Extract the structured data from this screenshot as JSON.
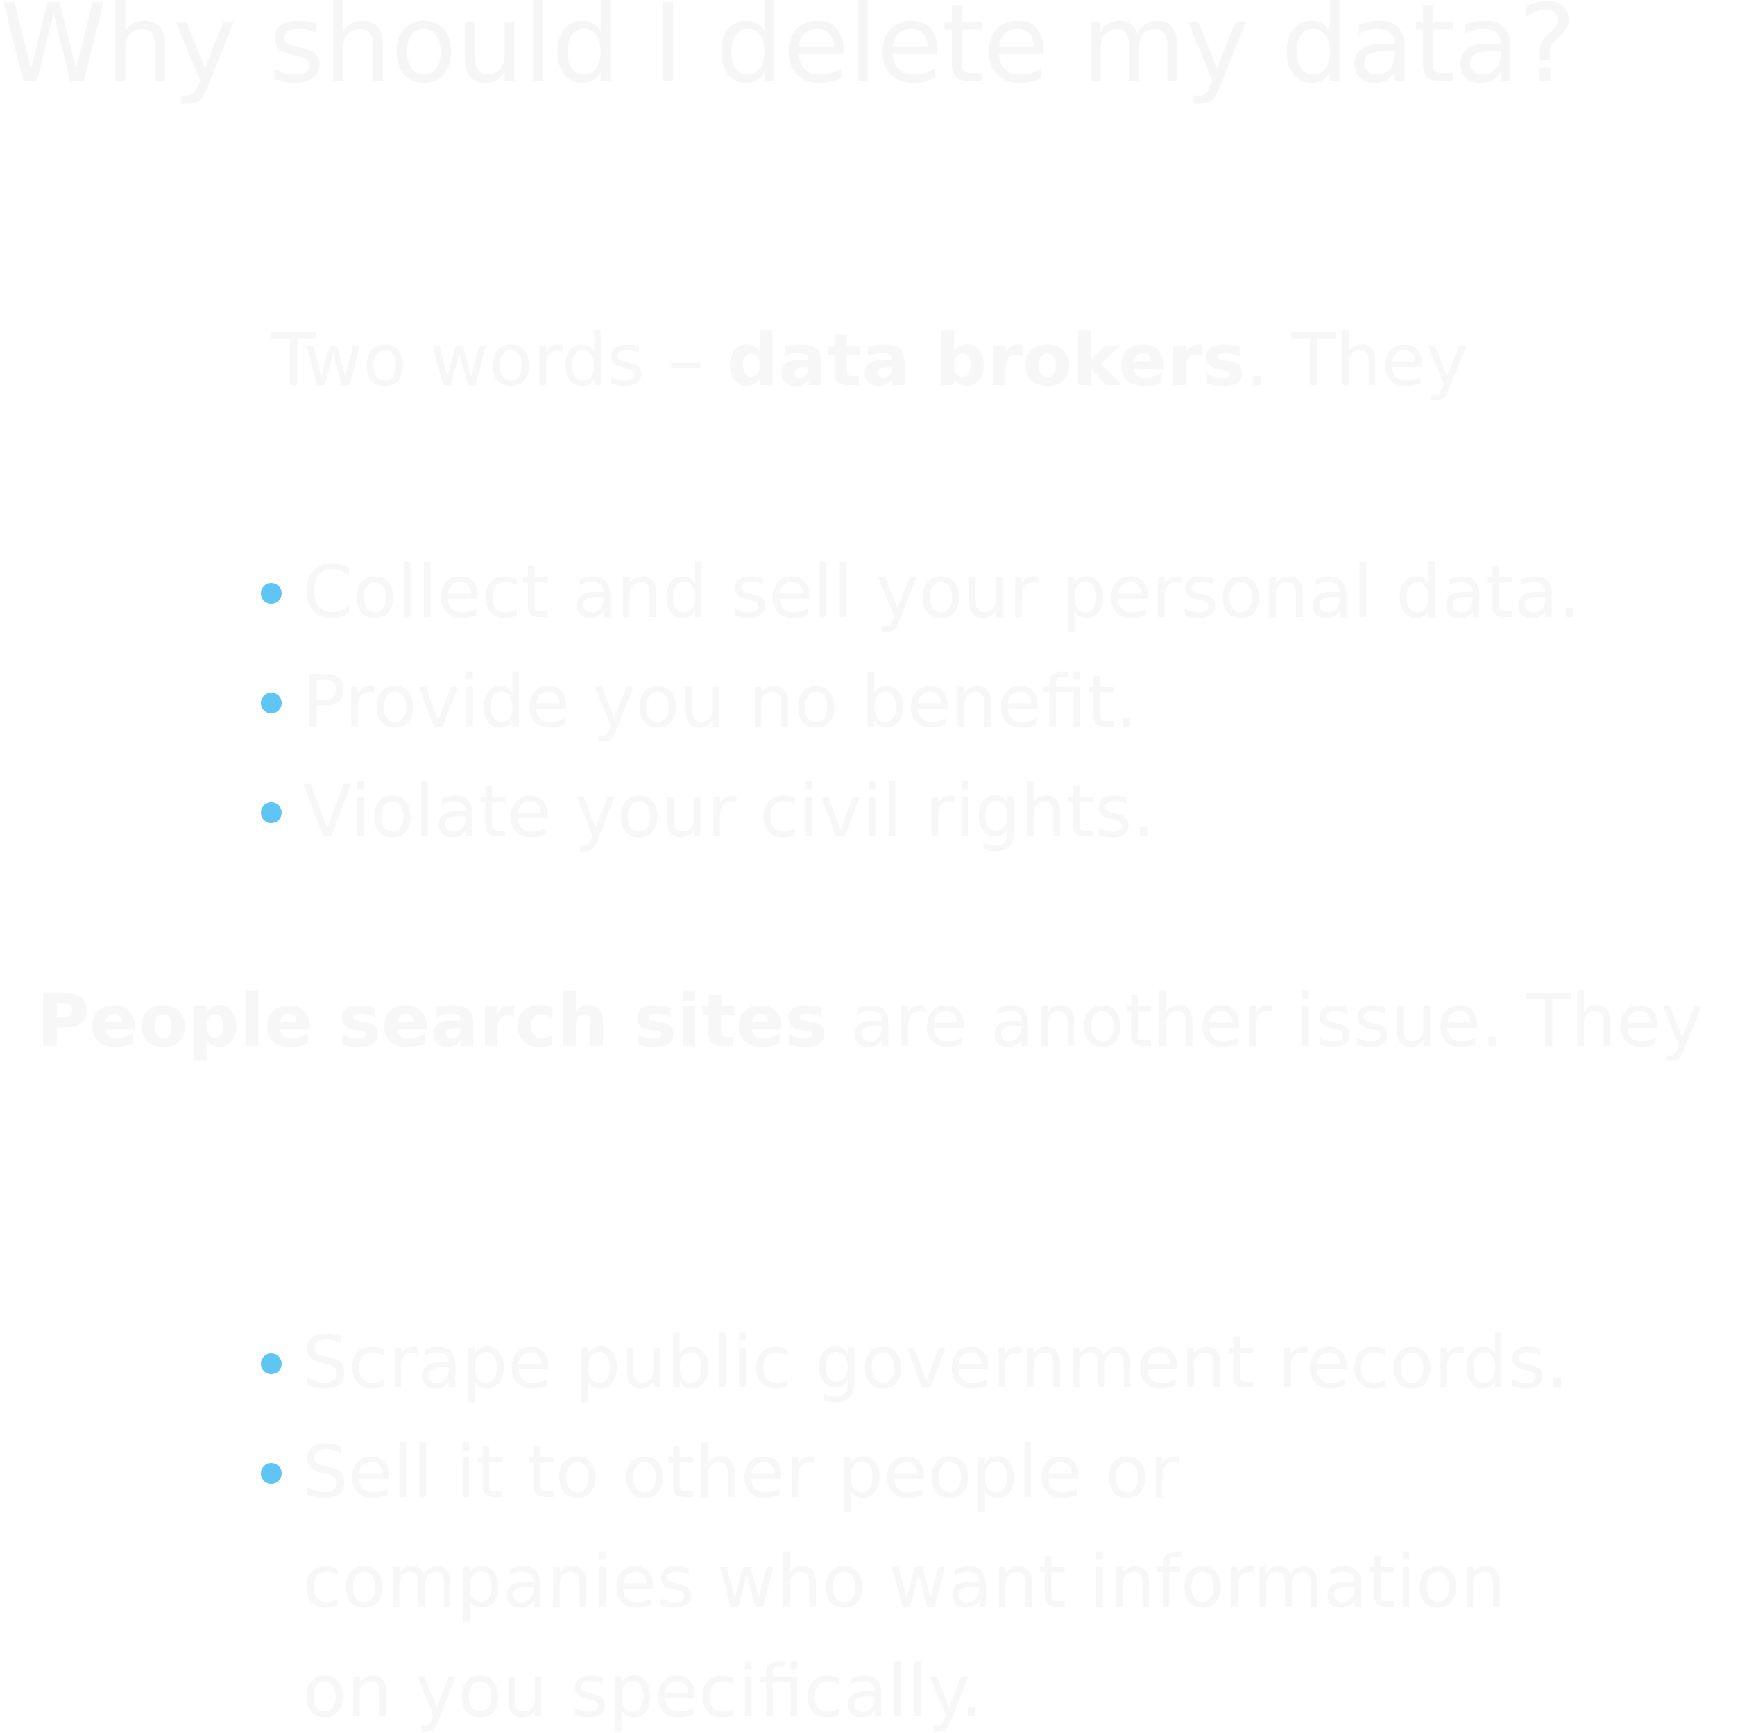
{
  "page": {
    "title": "Why should I delete my data?",
    "intro_1": {
      "before": "Two words – ",
      "bold": "data brokers",
      "after": ". They"
    },
    "list_1": [
      "Collect and sell your personal data.",
      "Provide you no benefit.",
      "Violate your civil rights."
    ],
    "intro_2": {
      "bold": "People search sites",
      "after": " are another issue. They"
    },
    "list_2": [
      "Scrape public government records.",
      "Sell it to other people or companies who want information on you specifically."
    ]
  },
  "colors": {
    "text": "#f7f7f7",
    "bullet": "#5fc5f2",
    "background": "#ffffff"
  }
}
